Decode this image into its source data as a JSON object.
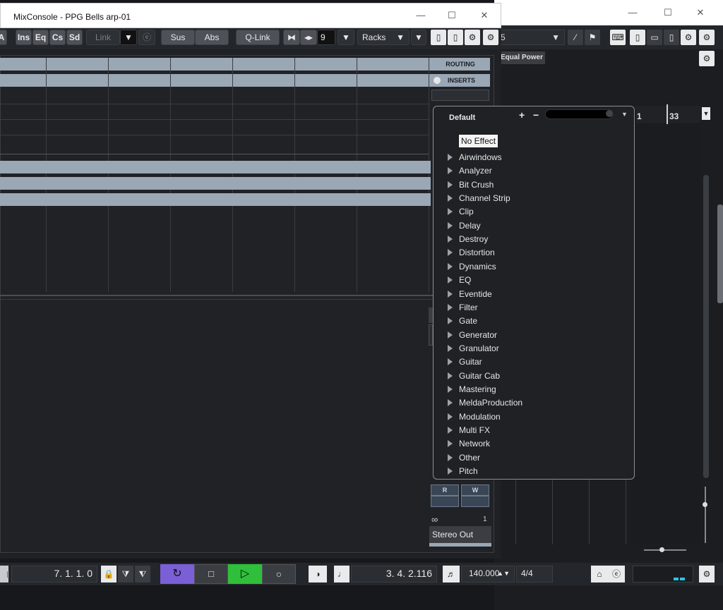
{
  "mixconsole": {
    "title": "MixConsole - PPG Bells arp-01",
    "toolbar": {
      "a_label": "A",
      "ins": "Ins",
      "eq": "Eq",
      "cs": "Cs",
      "sd": "Sd",
      "link": "Link",
      "sus": "Sus",
      "abs": "Abs",
      "qlink": "Q-Link",
      "channel_count": "9",
      "racks": "Racks"
    },
    "routing": "ROUTING",
    "inserts": "INSERTS",
    "rw": {
      "r": "R",
      "w": "W"
    },
    "channel_number": "1",
    "output": "Stereo Out"
  },
  "project": {
    "toolbar_value": "5",
    "equal_power": "Equal Power",
    "ruler": {
      "a": "1",
      "b": "33"
    }
  },
  "effects_menu": {
    "preset": "Default",
    "plus": "+",
    "minus": "−",
    "no_effect": "No Effect",
    "items": [
      "Airwindows",
      "Analyzer",
      "Bit Crush",
      "Channel Strip",
      "Clip",
      "Delay",
      "Destroy",
      "Distortion",
      "Dynamics",
      "EQ",
      "Eventide",
      "Filter",
      "Gate",
      "Generator",
      "Granulator",
      "Guitar",
      "Guitar Cab",
      "Mastering",
      "MeldaProduction",
      "Modulation",
      "Multi FX",
      "Network",
      "Other",
      "Pitch"
    ]
  },
  "transport": {
    "position": "7. 1. 1.   0",
    "time": "3.  4.  2.116",
    "tempo": "140.000",
    "signature": "4/4"
  },
  "colors": {
    "play": "#2fbf3a",
    "cycle": "#7b5fd6",
    "strip": "#9aa7b5"
  }
}
